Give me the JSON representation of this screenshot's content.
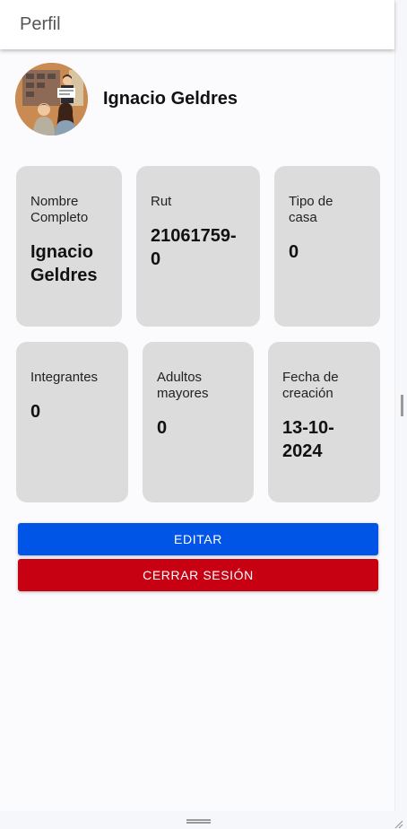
{
  "appbar": {
    "title": "Perfil"
  },
  "profile": {
    "name": "Ignacio Geldres"
  },
  "cards": [
    {
      "label": "Nombre Completo",
      "value": "Ignacio Geldres"
    },
    {
      "label": "Rut",
      "value": "21061759-0"
    },
    {
      "label": "Tipo de casa",
      "value": "0"
    },
    {
      "label": "Integrantes",
      "value": "0"
    },
    {
      "label": "Adultos mayores",
      "value": "0"
    },
    {
      "label": "Fecha de creación",
      "value": "13-10-2024"
    }
  ],
  "actions": {
    "edit_label": "EDITAR",
    "logout_label": "CERRAR SESIÓN"
  },
  "colors": {
    "edit": "#0055e6",
    "logout": "#c70012",
    "card": "#dcdcdc"
  }
}
